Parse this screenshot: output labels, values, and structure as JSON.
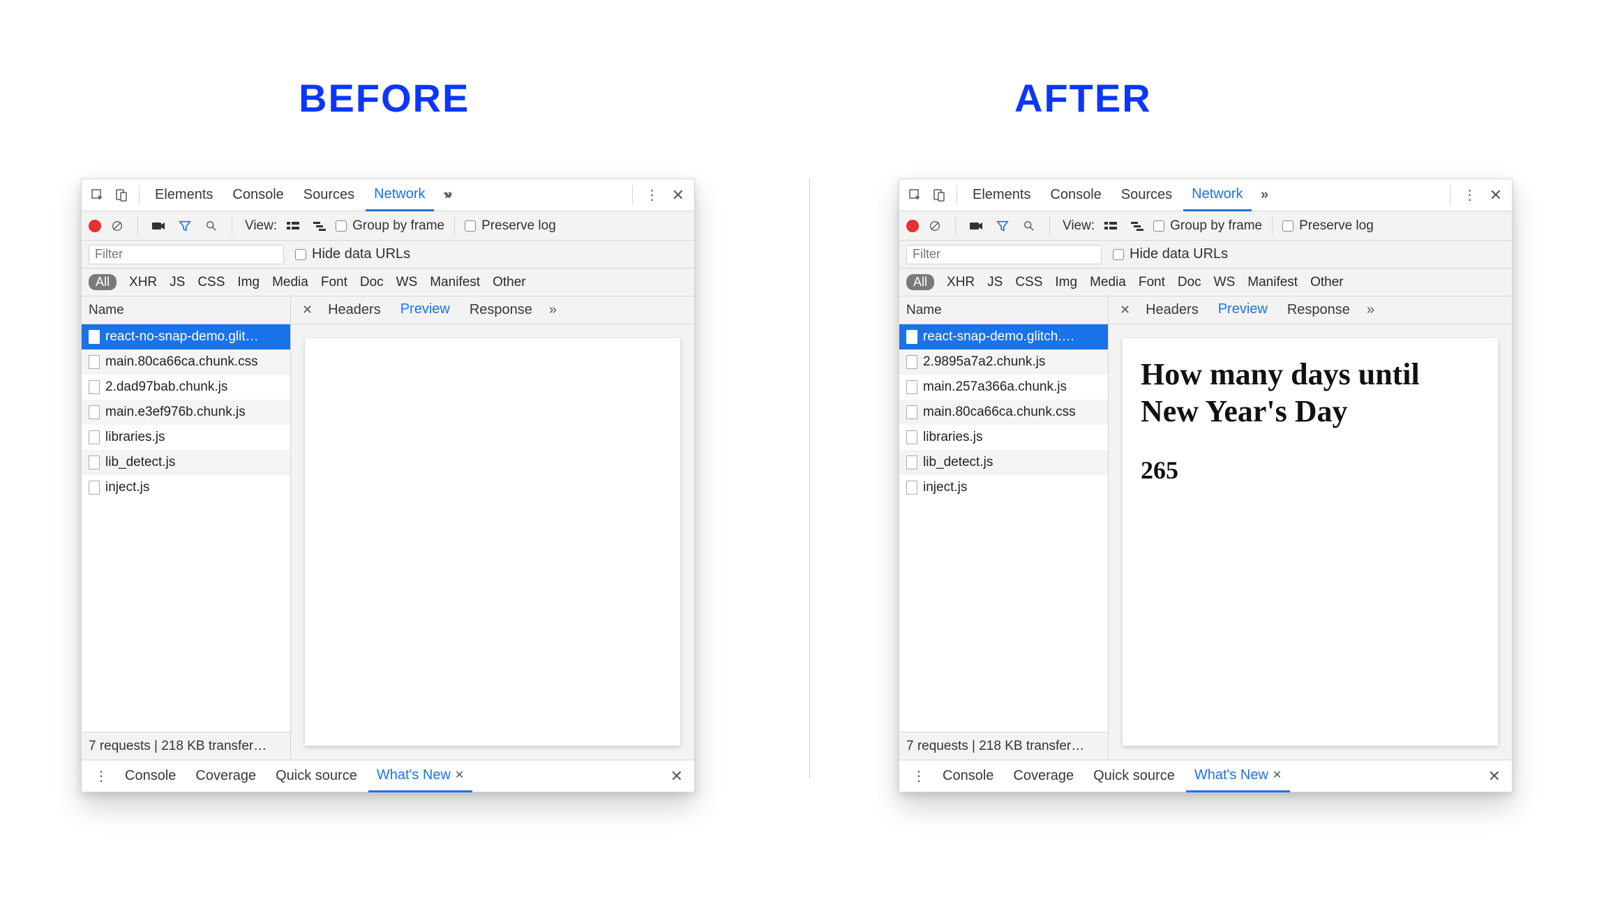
{
  "headings": {
    "before": "BEFORE",
    "after": "AFTER"
  },
  "top_tabs": {
    "elements": "Elements",
    "console": "Console",
    "sources": "Sources",
    "network": "Network"
  },
  "toolbar": {
    "view": "View:",
    "group_by_frame": "Group by frame",
    "preserve_log": "Preserve log"
  },
  "filter": {
    "placeholder": "Filter",
    "hide_data_urls": "Hide data URLs"
  },
  "types": {
    "all": "All",
    "xhr": "XHR",
    "js": "JS",
    "css": "CSS",
    "img": "Img",
    "media": "Media",
    "font": "Font",
    "doc": "Doc",
    "ws": "WS",
    "manifest": "Manifest",
    "other": "Other"
  },
  "columns": {
    "name": "Name"
  },
  "detail_tabs": {
    "headers": "Headers",
    "preview": "Preview",
    "response": "Response"
  },
  "status": "7 requests | 218 KB transfer…",
  "drawer": {
    "console": "Console",
    "coverage": "Coverage",
    "quick_source": "Quick source",
    "whats_new": "What's New"
  },
  "before": {
    "requests": [
      "react-no-snap-demo.glit…",
      "main.80ca66ca.chunk.css",
      "2.dad97bab.chunk.js",
      "main.e3ef976b.chunk.js",
      "libraries.js",
      "lib_detect.js",
      "inject.js"
    ],
    "preview": {
      "heading": "",
      "value": ""
    }
  },
  "after": {
    "requests": [
      "react-snap-demo.glitch.…",
      "2.9895a7a2.chunk.js",
      "main.257a366a.chunk.js",
      "main.80ca66ca.chunk.css",
      "libraries.js",
      "lib_detect.js",
      "inject.js"
    ],
    "preview": {
      "heading": "How many days until New Year's Day",
      "value": "265"
    }
  }
}
